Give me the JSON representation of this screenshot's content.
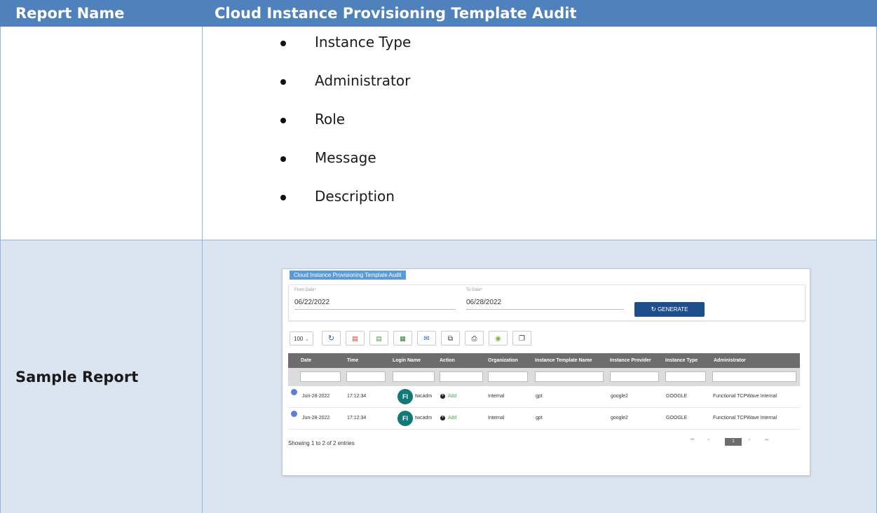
{
  "header": {
    "col1": "Report Name",
    "col2": "Cloud Instance Provisioning Template Audit"
  },
  "bullets": [
    "Instance Type",
    "Administrator",
    "Role",
    "Message",
    "Description"
  ],
  "sample_label": "Sample Report",
  "screenshot": {
    "tab_title": "Cloud Instance Provisioning Template Audit",
    "from_label": "From Date*",
    "from_value": "06/22/2022",
    "to_label": "To Date*",
    "to_value": "06/28/2022",
    "generate_label": "GENERATE",
    "page_size": "100",
    "toolbar_icons": [
      "refresh-icon",
      "pdf-icon",
      "csv-icon",
      "excel-icon",
      "email-icon",
      "copy-icon",
      "print-icon",
      "column-visibility-icon",
      "restore-icon"
    ],
    "columns": [
      "Date",
      "Time",
      "Login Name",
      "Action",
      "Organization",
      "Instance Template Name",
      "Instance Provider",
      "Instance Type",
      "Administrator"
    ],
    "rows": [
      {
        "date": "Jun-28-2022",
        "time": "17:12:34",
        "avatar": "FI",
        "login": "twcadm",
        "action": "Add",
        "org": "Internal",
        "template": "gpt",
        "provider": "google2",
        "type": "GOOGLE",
        "admin": "Functional TCPWave Internal"
      },
      {
        "date": "Jun-28-2022",
        "time": "17:12:34",
        "avatar": "FI",
        "login": "twcadm",
        "action": "Add",
        "org": "Internal",
        "template": "gpt",
        "provider": "google2",
        "type": "GOOGLE",
        "admin": "Functional TCPWave Internal"
      }
    ],
    "showing": "Showing 1 to 2 of 2 entries",
    "current_page": "1",
    "colors": {
      "header_bar": "#4f81bd",
      "row_band": "#dbe5f1",
      "generate": "#1f4e8c",
      "grid_head": "#6d6d6d",
      "avatar": "#117a78",
      "add": "#4caf50"
    }
  }
}
